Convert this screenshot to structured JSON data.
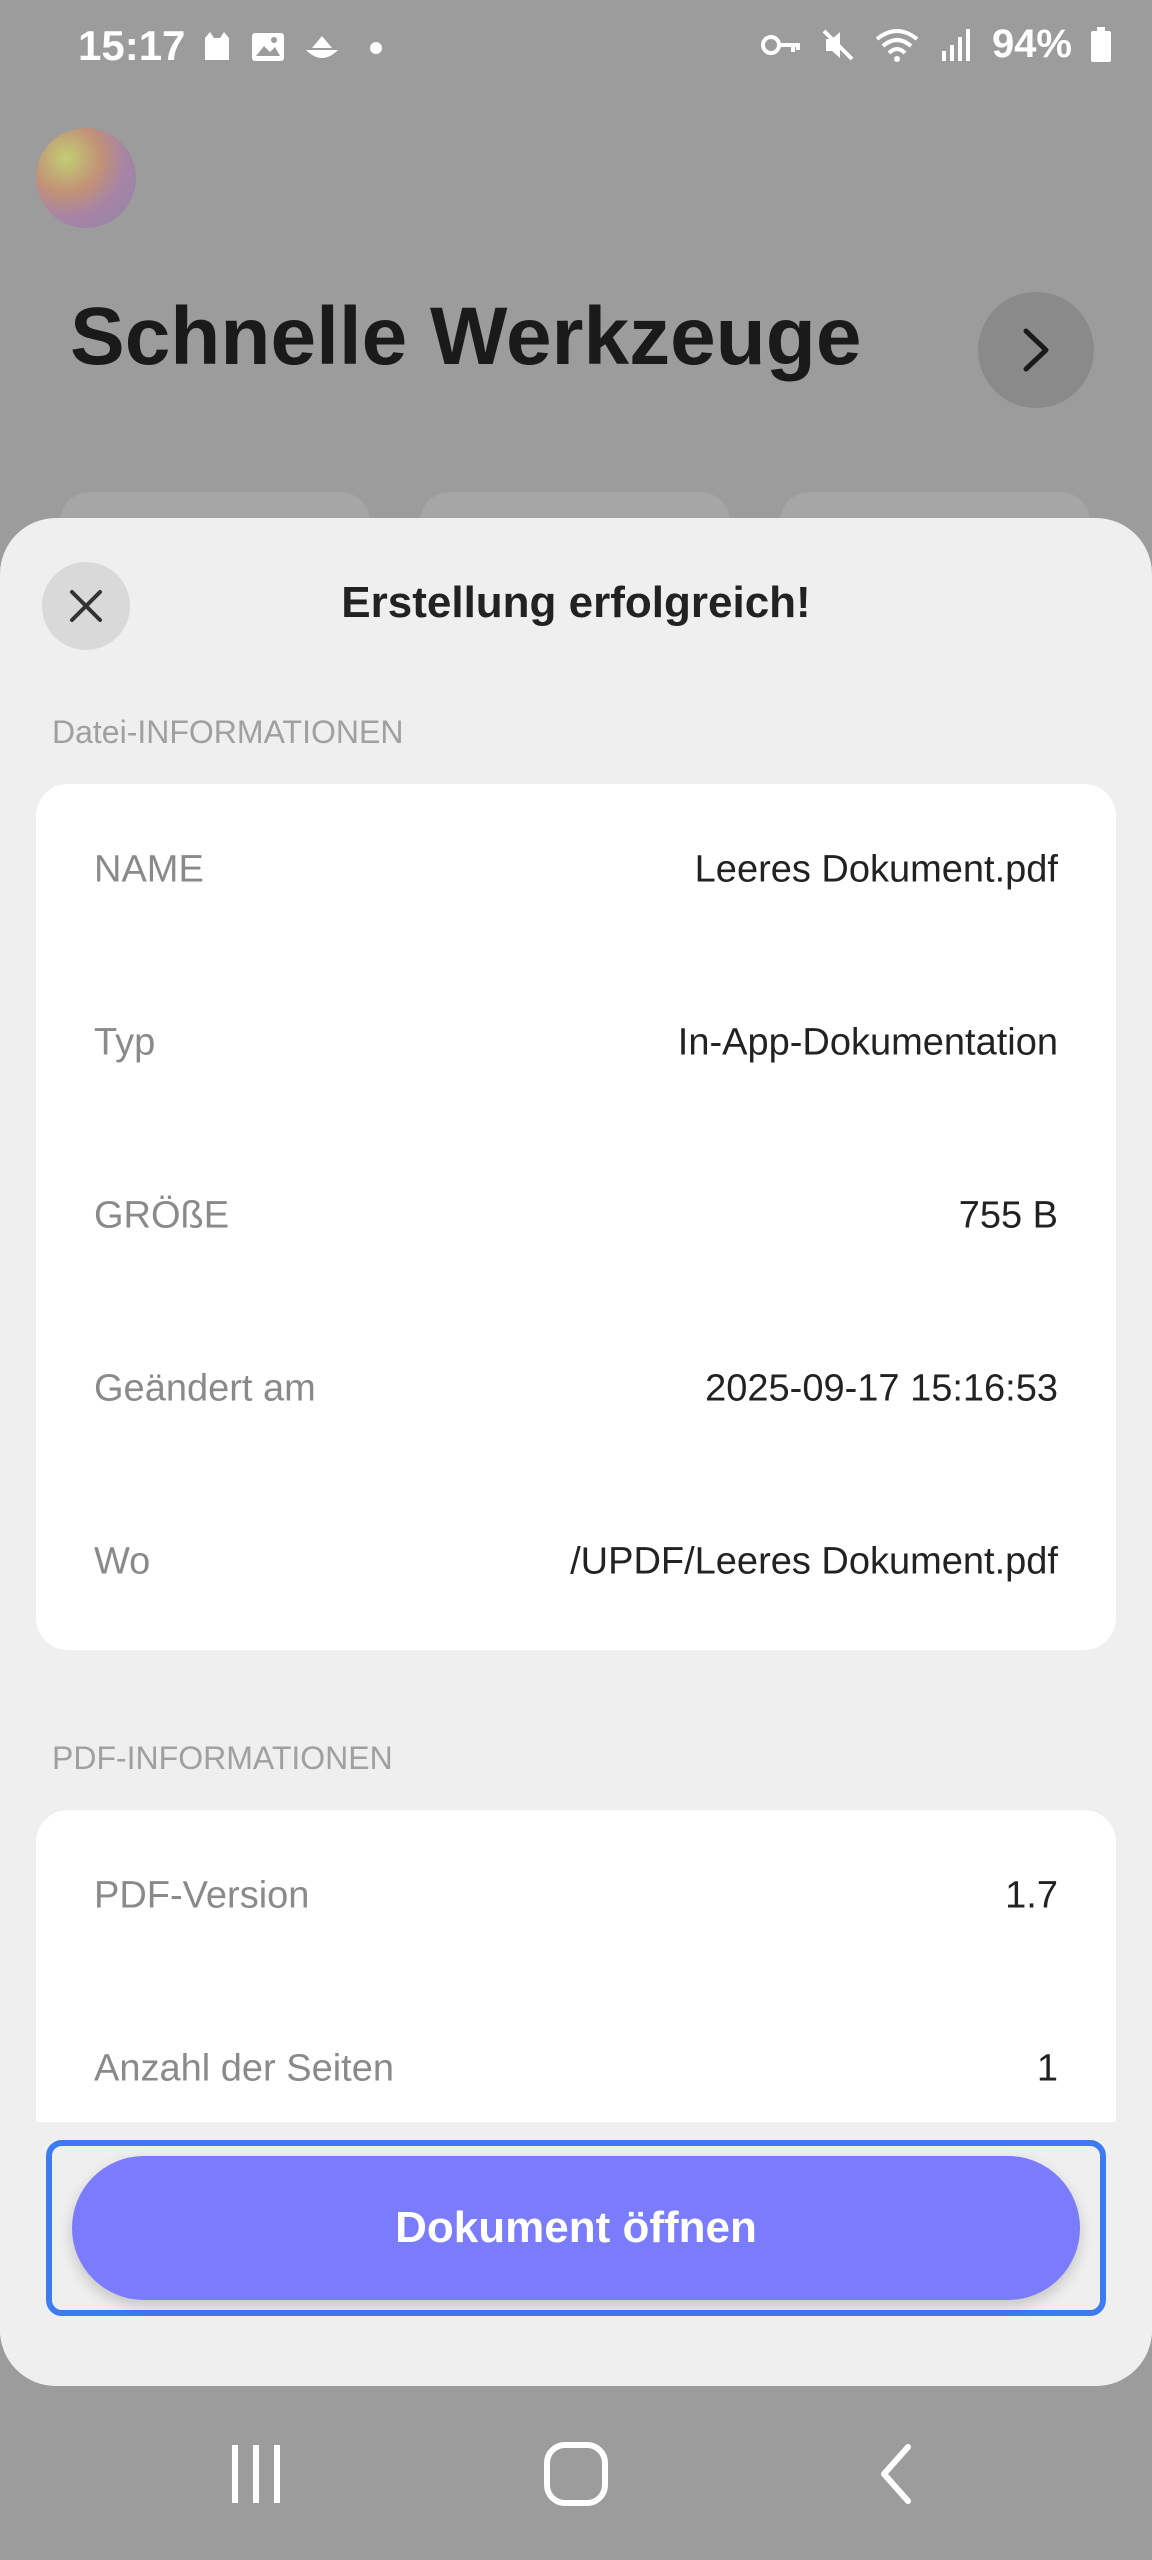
{
  "status_bar": {
    "time": "15:17",
    "battery": "94%",
    "icons_left": [
      "cat-notification-icon",
      "image-icon",
      "cloud-sync-icon",
      "dot-icon"
    ],
    "icons_right": [
      "key-icon",
      "mute-icon",
      "wifi-icon",
      "signal-icon",
      "battery-icon"
    ]
  },
  "background": {
    "title": "Schnelle Werkzeuge"
  },
  "sheet": {
    "title": "Erstellung erfolgreich!",
    "file_section_label": "Datei-INFORMATIONEN",
    "file_rows": [
      {
        "key": "NAME",
        "value": "Leeres Dokument.pdf"
      },
      {
        "key": "Typ",
        "value": "In-App-Dokumentation"
      },
      {
        "key": "GRÖßE",
        "value": "755 B"
      },
      {
        "key": "Geändert am",
        "value": "2025-09-17 15:16:53"
      },
      {
        "key": "Wo",
        "value": "/UPDF/Leeres Dokument.pdf"
      }
    ],
    "pdf_section_label": "PDF-INFORMATIONEN",
    "pdf_rows": [
      {
        "key": "PDF-Version",
        "value": "1.7"
      },
      {
        "key": "Anzahl der Seiten",
        "value": "1"
      }
    ],
    "open_button": "Dokument öffnen"
  },
  "colors": {
    "accent": "#7a7cfb",
    "focus_border": "#3d7bf0",
    "sheet_bg": "#efefef"
  }
}
